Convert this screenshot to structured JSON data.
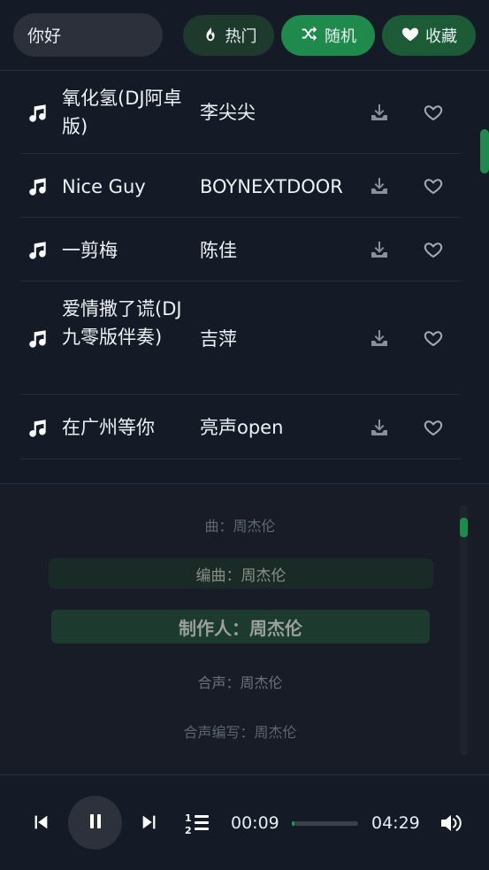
{
  "search": {
    "value": "你好"
  },
  "filters": {
    "hot": "热门",
    "random": "随机",
    "favorites": "收藏"
  },
  "songs": [
    {
      "title": "氧化氢(DJ阿卓版)",
      "artist": "李尖尖"
    },
    {
      "title": "Nice Guy",
      "artist": "BOYNEXTDOOR"
    },
    {
      "title": "一剪梅",
      "artist": "陈佳"
    },
    {
      "title": "爱情撒了谎(DJ九零版伴奏)",
      "artist": "吉萍"
    },
    {
      "title": "在广州等你",
      "artist": "亮声open"
    }
  ],
  "lyrics": [
    "曲：周杰伦",
    "编曲：周杰伦",
    "制作人：周杰伦",
    "合声：周杰伦",
    "合声编写：周杰伦"
  ],
  "player": {
    "current_time": "00:09",
    "total_time": "04:29",
    "progress": 0.035
  },
  "colors": {
    "accent": "#1f8a4b",
    "background": "#151b26"
  },
  "icons": {
    "hot": "flame-icon",
    "random": "shuffle-icon",
    "favorites": "heart-icon",
    "song": "music-note-icon",
    "download": "download-icon",
    "like": "heart-outline-icon",
    "prev": "skip-back-icon",
    "play": "pause-icon",
    "next": "skip-forward-icon",
    "queue": "playlist-icon",
    "volume": "volume-icon"
  }
}
